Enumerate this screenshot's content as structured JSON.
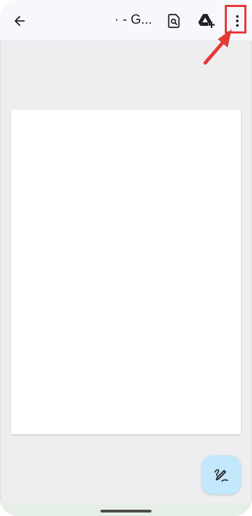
{
  "topbar": {
    "title": "· - G...",
    "back_icon": "arrow-back-icon",
    "find_icon": "find-in-page-icon",
    "drive_icon": "add-to-drive-icon",
    "more_icon": "more-vert-icon"
  },
  "annotation": {
    "highlight_color": "#e53935"
  },
  "fab": {
    "icon": "edit-annotate-icon",
    "color": "#c3e7fb"
  }
}
